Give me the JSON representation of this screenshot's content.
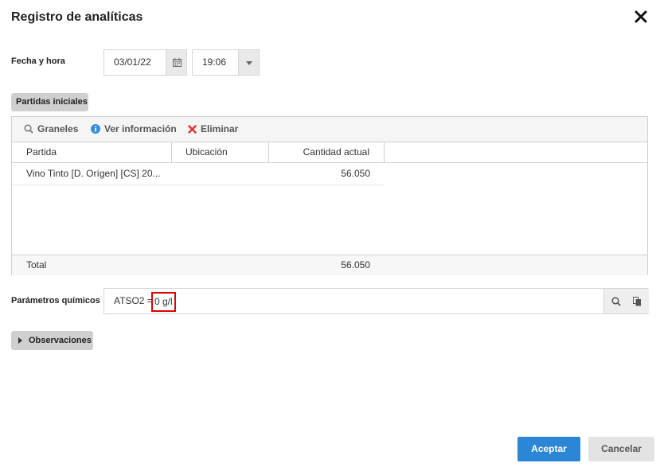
{
  "dialog": {
    "title": "Registro de analíticas"
  },
  "datetime": {
    "label": "Fecha y hora",
    "date": "03/01/22",
    "time": "19:06"
  },
  "partidas": {
    "section_label": "Partidas iniciales",
    "toolbar": {
      "graneles": "Graneles",
      "ver_informacion": "Ver información",
      "eliminar": "Eliminar"
    },
    "columns": [
      "Partida",
      "Ubicación",
      "Cantidad actual"
    ],
    "rows": [
      {
        "partida": "Vino Tinto [D. Orígen] [CS] 20...",
        "ubicacion": "",
        "cantidad": "56.050"
      }
    ],
    "total_label": "Total",
    "total_value": "56.050"
  },
  "parametros": {
    "label": "Parámetros químicos",
    "prefix": "ATSO2 =",
    "value": "0 g/l"
  },
  "observaciones": {
    "label": "Observaciones"
  },
  "buttons": {
    "accept": "Aceptar",
    "cancel": "Cancelar"
  },
  "colors": {
    "accent": "#2b86d6",
    "delete": "#e0312f",
    "info": "#3a8fd9",
    "highlight": "#e00000"
  }
}
